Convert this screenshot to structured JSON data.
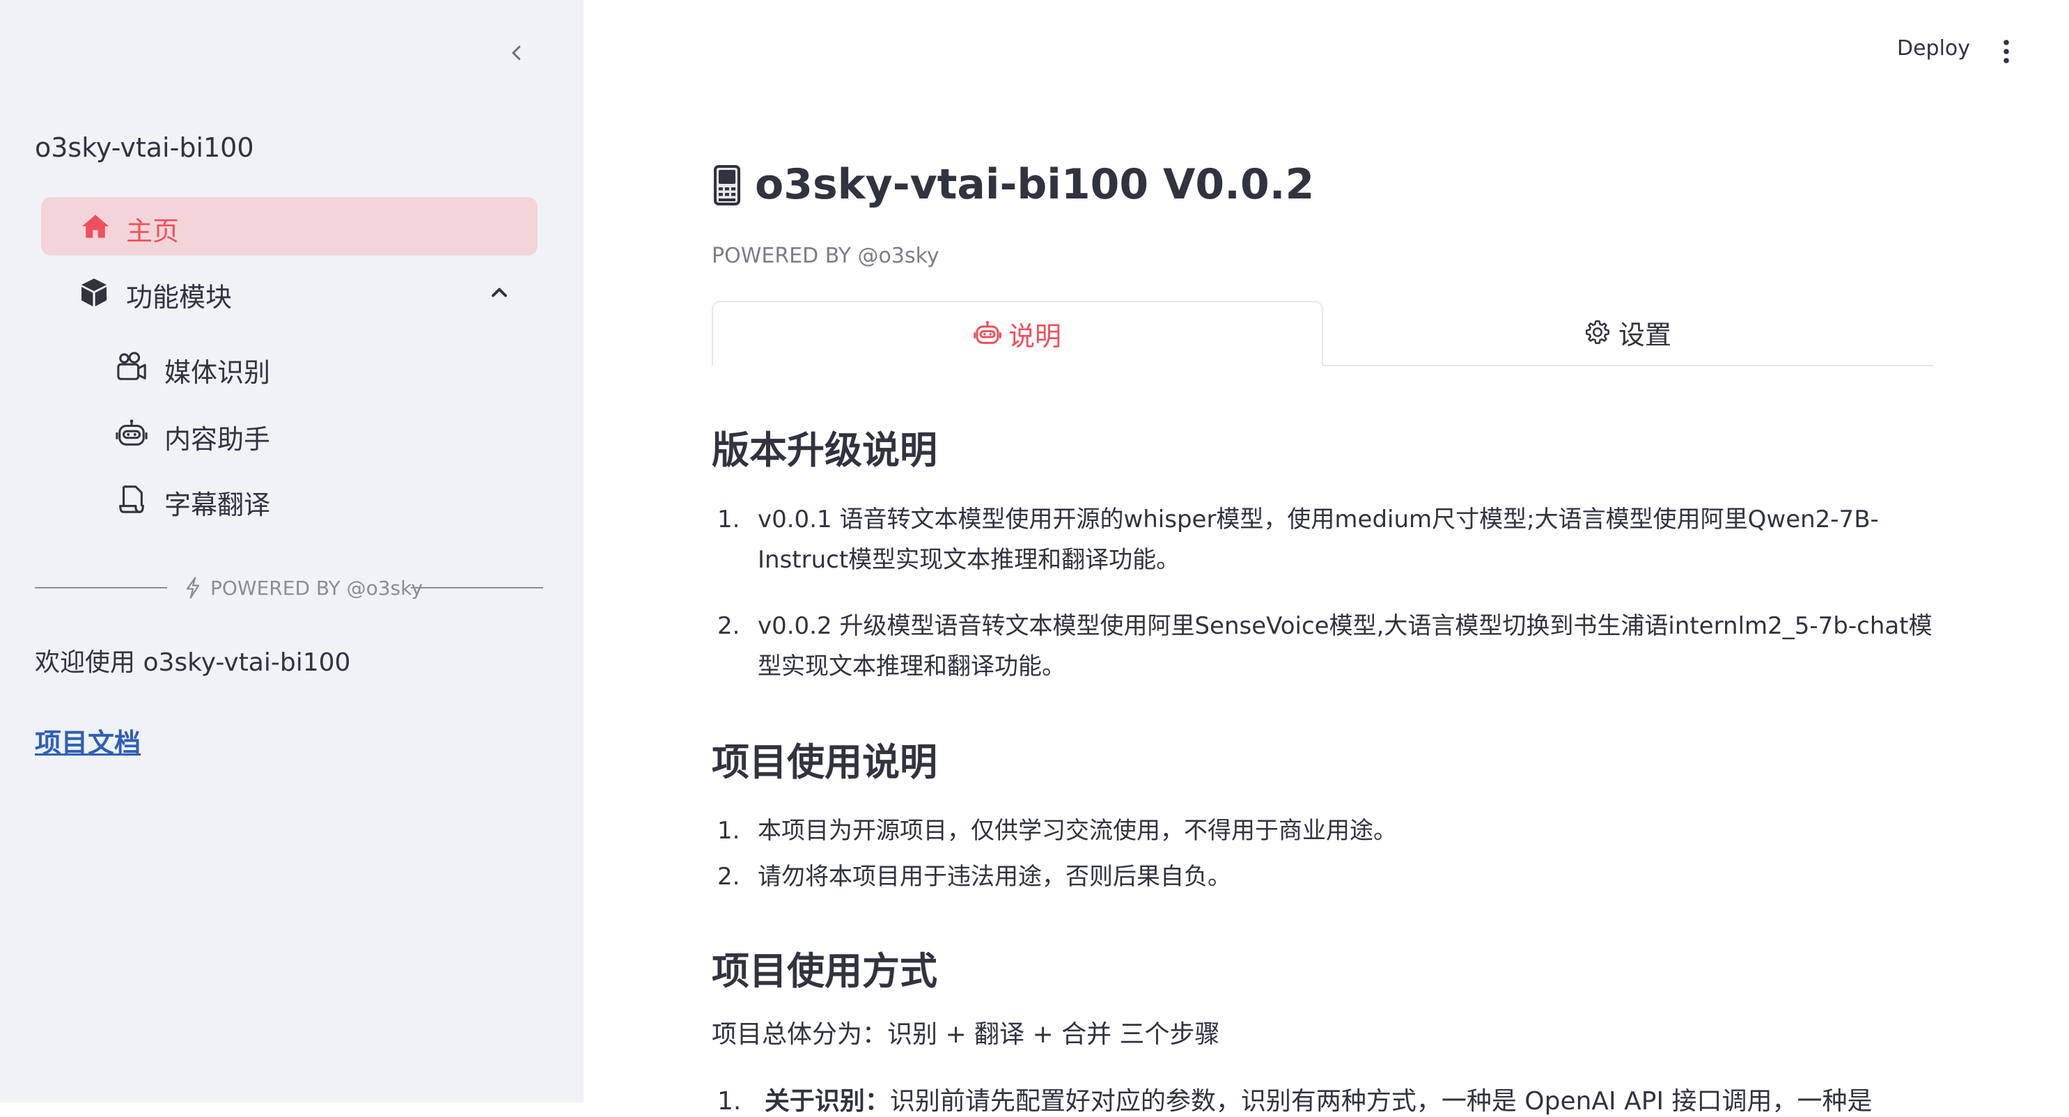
{
  "sidebar": {
    "app_name": "o3sky-vtai-bi100",
    "nav_home": "主页",
    "nav_group": "功能模块",
    "sub_items": [
      {
        "label": "媒体识别",
        "icon": "camera-icon"
      },
      {
        "label": "内容助手",
        "icon": "robot-icon"
      },
      {
        "label": "字幕翻译",
        "icon": "document-icon"
      }
    ],
    "divider_text": "POWERED BY @o3sky",
    "welcome": "欢迎使用 o3sky-vtai-bi100",
    "doc_link": "项目文档"
  },
  "header": {
    "deploy": "Deploy"
  },
  "main": {
    "title": "o3sky-vtai-bi100 V0.0.2",
    "powered_by": "POWERED BY @o3sky",
    "tabs": [
      {
        "label": "说明",
        "icon": "robot-icon",
        "active": true
      },
      {
        "label": "设置",
        "icon": "gear-icon",
        "active": false
      }
    ],
    "section1": {
      "heading": "版本升级说明",
      "items": [
        {
          "num": "1.",
          "text": "v0.0.1 语音转文本模型使用开源的whisper模型，使用medium尺寸模型;大语言模型使用阿里Qwen2-7B-Instruct模型实现文本推理和翻译功能。"
        },
        {
          "num": "2.",
          "text": "v0.0.2 升级模型语音转文本模型使用阿里SenseVoice模型,大语言模型切换到书生浦语internlm2_5-7b-chat模型实现文本推理和翻译功能。"
        }
      ]
    },
    "section2": {
      "heading": "项目使用说明",
      "items": [
        {
          "num": "1.",
          "text": "本项目为开源项目，仅供学习交流使用，不得用于商业用途。"
        },
        {
          "num": "2.",
          "text": "请勿将本项目用于违法用途，否则后果自负。"
        }
      ]
    },
    "section3": {
      "heading": "项目使用方式",
      "paragraph": "项目总体分为：识别 + 翻译 + 合并 三个步骤",
      "cut_item_num": "1.",
      "cut_item_bold": "关于识别：",
      "cut_item_text": "识别前请先配置好对应的参数，识别有两种方式，一种是 OpenAI API 接口调用，一种是"
    }
  }
}
